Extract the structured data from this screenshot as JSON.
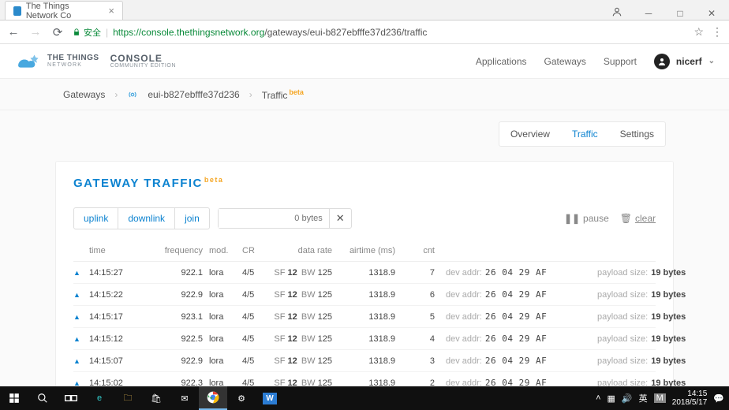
{
  "browser": {
    "tab_title": "The Things Network Co",
    "secure_label": "安全",
    "url_host": "https://console.thethingsnetwork.org",
    "url_path": "/gateways/eui-b827ebfffe37d236/traffic"
  },
  "header": {
    "logo_line1": "THE THINGS",
    "logo_line2": "NETWORK",
    "console_line1": "CONSOLE",
    "console_line2": "COMMUNITY EDITION",
    "nav": {
      "applications": "Applications",
      "gateways": "Gateways",
      "support": "Support"
    },
    "username": "nicerf"
  },
  "breadcrumbs": {
    "root": "Gateways",
    "gateway_id": "eui-b827ebfffe37d236",
    "leaf": "Traffic",
    "beta": "beta"
  },
  "tabs": {
    "overview": "Overview",
    "traffic": "Traffic",
    "settings": "Settings"
  },
  "panel": {
    "title": "GATEWAY TRAFFIC",
    "beta": "beta",
    "filters": {
      "uplink": "uplink",
      "downlink": "downlink",
      "join": "join"
    },
    "search_placeholder": "0 bytes",
    "pause": "pause",
    "clear": "clear"
  },
  "columns": {
    "time": "time",
    "frequency": "frequency",
    "mod": "mod.",
    "cr": "CR",
    "data_rate": "data rate",
    "airtime": "airtime (ms)",
    "cnt": "cnt"
  },
  "row_labels": {
    "sf": "SF",
    "bw": "BW",
    "dev_addr": "dev addr:",
    "payload_size": "payload size:"
  },
  "rows": [
    {
      "time": "14:15:27",
      "freq": "922.1",
      "mod": "lora",
      "cr": "4/5",
      "sf": "12",
      "bw": "125",
      "airtime": "1318.9",
      "cnt": "7",
      "dev_addr": "26 04 29 AF",
      "payload": "19 bytes"
    },
    {
      "time": "14:15:22",
      "freq": "922.9",
      "mod": "lora",
      "cr": "4/5",
      "sf": "12",
      "bw": "125",
      "airtime": "1318.9",
      "cnt": "6",
      "dev_addr": "26 04 29 AF",
      "payload": "19 bytes"
    },
    {
      "time": "14:15:17",
      "freq": "923.1",
      "mod": "lora",
      "cr": "4/5",
      "sf": "12",
      "bw": "125",
      "airtime": "1318.9",
      "cnt": "5",
      "dev_addr": "26 04 29 AF",
      "payload": "19 bytes"
    },
    {
      "time": "14:15:12",
      "freq": "922.5",
      "mod": "lora",
      "cr": "4/5",
      "sf": "12",
      "bw": "125",
      "airtime": "1318.9",
      "cnt": "4",
      "dev_addr": "26 04 29 AF",
      "payload": "19 bytes"
    },
    {
      "time": "14:15:07",
      "freq": "922.9",
      "mod": "lora",
      "cr": "4/5",
      "sf": "12",
      "bw": "125",
      "airtime": "1318.9",
      "cnt": "3",
      "dev_addr": "26 04 29 AF",
      "payload": "19 bytes"
    },
    {
      "time": "14:15:02",
      "freq": "922.3",
      "mod": "lora",
      "cr": "4/5",
      "sf": "12",
      "bw": "125",
      "airtime": "1318.9",
      "cnt": "2",
      "dev_addr": "26 04 29 AF",
      "payload": "19 bytes"
    }
  ],
  "taskbar": {
    "time": "14:15",
    "date": "2018/5/17",
    "ime": "英",
    "tray_m": "M"
  }
}
